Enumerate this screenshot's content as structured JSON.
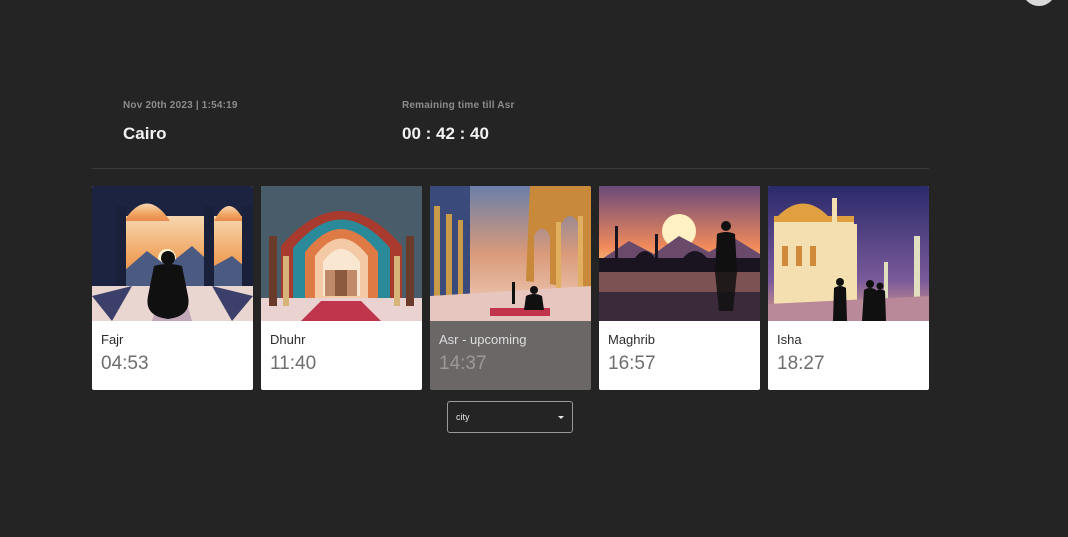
{
  "header": {
    "datetime": "Nov 20th 2023 | 1:54:19",
    "city": "Cairo",
    "remaining_label": "Remaining time till Asr",
    "countdown": "00 : 42 : 40"
  },
  "prayers": [
    {
      "name": "Fajr",
      "time": "04:53",
      "upcoming": false
    },
    {
      "name": "Dhuhr",
      "time": "11:40",
      "upcoming": false
    },
    {
      "name": "Asr - upcoming",
      "time": "14:37",
      "upcoming": true
    },
    {
      "name": "Maghrib",
      "time": "16:57",
      "upcoming": false
    },
    {
      "name": "Isha",
      "time": "18:27",
      "upcoming": false
    }
  ],
  "city_select": {
    "value": "city"
  },
  "colors": {
    "background": "#242424",
    "card": "#ffffff",
    "card_upcoming": "#6b6767"
  },
  "icons": {
    "dropdown": "chevron-down-icon"
  }
}
